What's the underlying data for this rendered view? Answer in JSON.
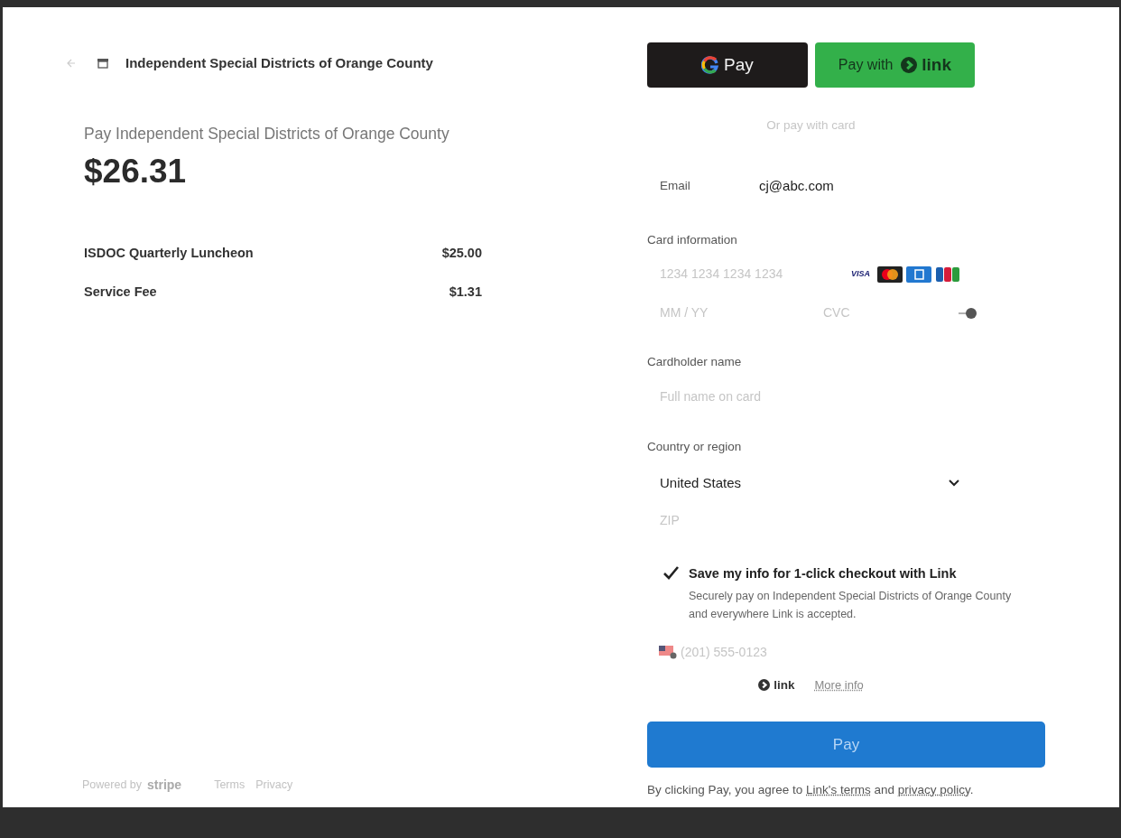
{
  "merchant": {
    "name": "Independent Special Districts of Orange County"
  },
  "summary": {
    "title": "Pay Independent Special Districts of Orange County",
    "total": "$26.31"
  },
  "line_items": [
    {
      "label": "ISDOC Quarterly Luncheon",
      "amount": "$25.00"
    },
    {
      "label": "Service Fee",
      "amount": "$1.31"
    }
  ],
  "footer": {
    "powered_by": "Powered by",
    "brand": "stripe",
    "links": [
      "Terms",
      "Privacy"
    ]
  },
  "wallet_buttons": [
    {
      "kind": "gpay",
      "label": "Pay"
    },
    {
      "kind": "link",
      "label": "Pay with",
      "brand": "link"
    }
  ],
  "divider_text": "Or pay with card",
  "email": {
    "label": "Email",
    "value": "cj@abc.com"
  },
  "card": {
    "label": "Card information",
    "number_placeholder": "1234 1234 1234 1234",
    "expiry_placeholder": "MM / YY",
    "cvc_placeholder": "CVC",
    "brands": [
      {
        "kind": "visa",
        "label": "VISA"
      },
      {
        "kind": "mastercard"
      },
      {
        "kind": "amex"
      },
      {
        "kind": "jcb"
      }
    ]
  },
  "cardholder": {
    "label": "Cardholder name",
    "placeholder": "Full name on card"
  },
  "country": {
    "label": "Country or region",
    "value": "United States",
    "zip_placeholder": "ZIP"
  },
  "save_info": {
    "checked": true,
    "title": "Save my info for 1-click checkout with Link",
    "description": "Securely pay on Independent Special Districts of Orange County and everywhere Link is accepted."
  },
  "phone": {
    "placeholder": "(201) 555-0123"
  },
  "link_row": {
    "brand": "link",
    "more_info": "More info"
  },
  "pay_button": {
    "label": "Pay"
  },
  "terms": {
    "prefix": "By clicking Pay, you agree to ",
    "link_1": "Link's terms",
    "middle": " and ",
    "link_2": "privacy policy",
    "suffix": "."
  }
}
